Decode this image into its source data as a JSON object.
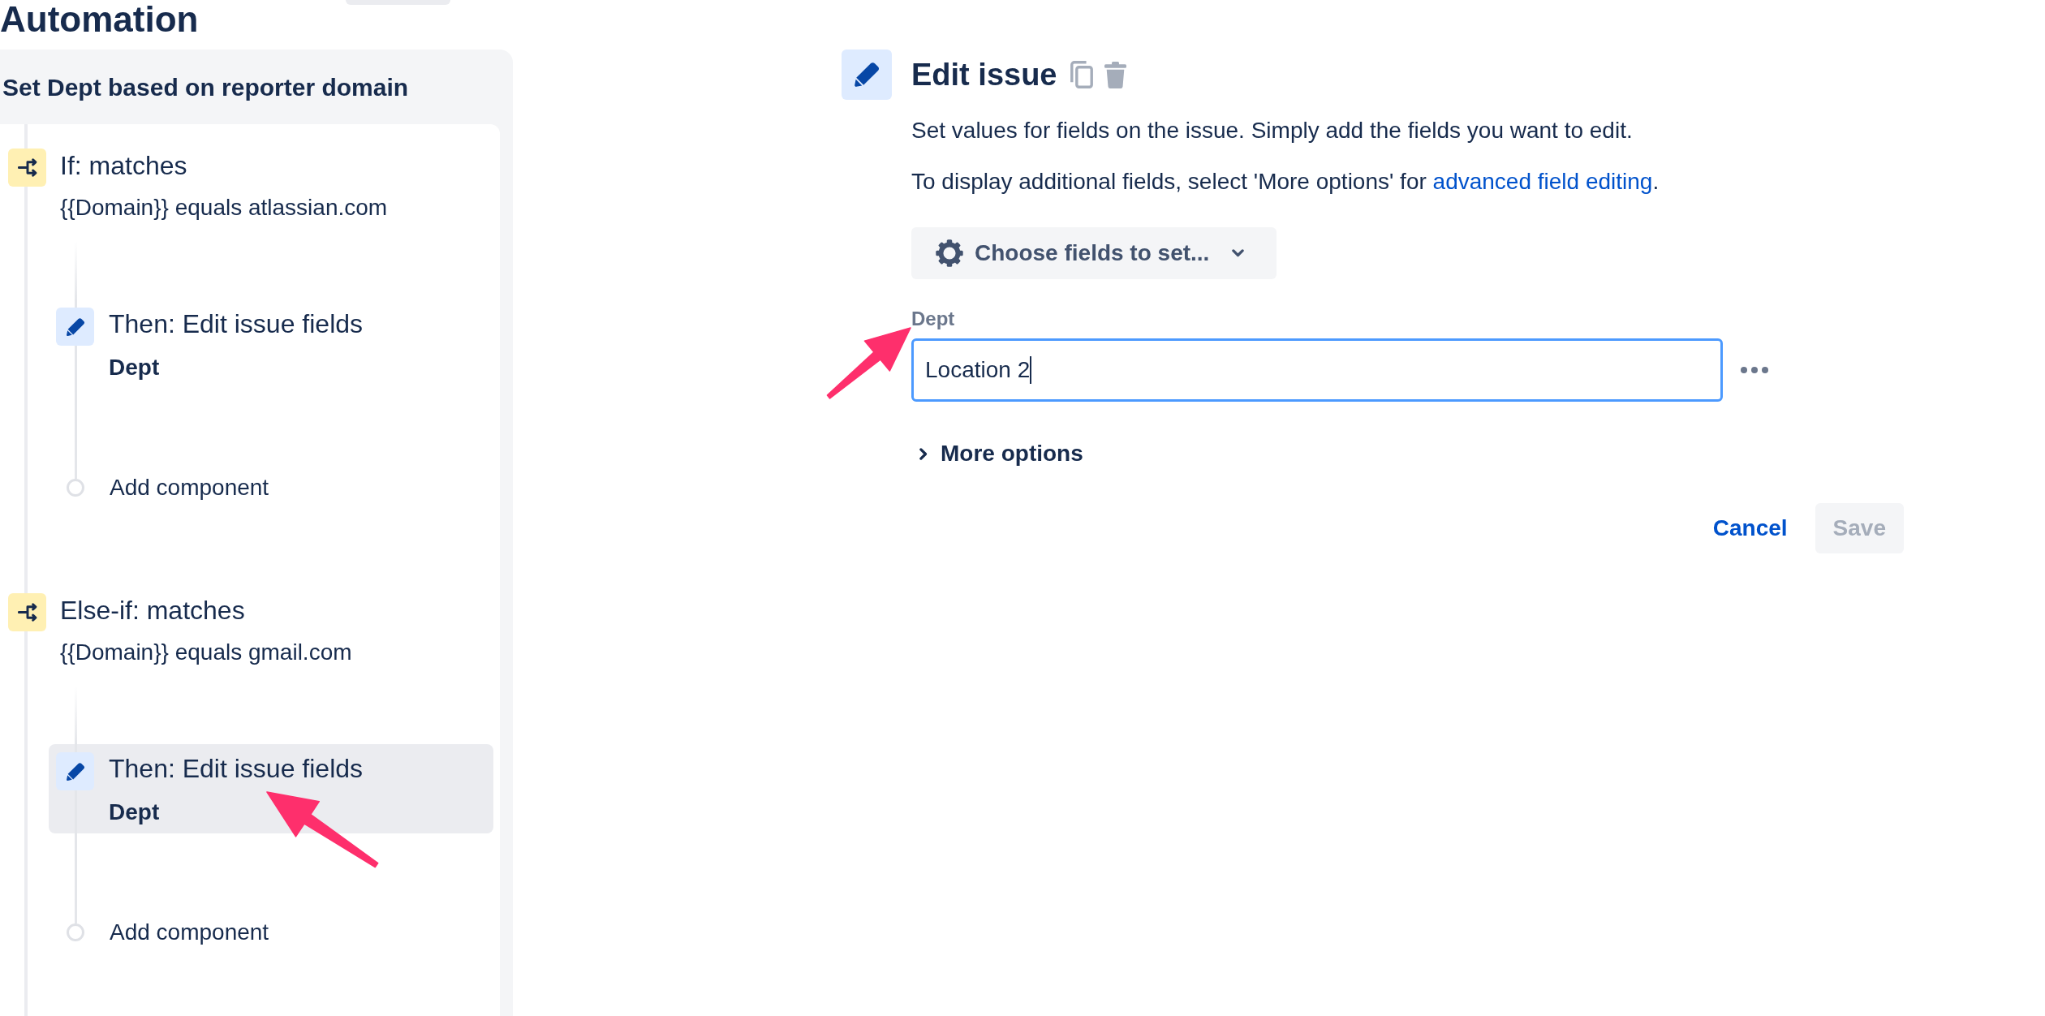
{
  "header": {
    "title": "Automation"
  },
  "rule": {
    "name": "Set Dept based on reporter domain",
    "components": [
      {
        "kind": "condition",
        "title": "If: matches",
        "detail": "{{Domain}} equals atlassian.com",
        "selected": false,
        "children": [
          {
            "kind": "action",
            "title": "Then: Edit issue fields",
            "detail": "Dept",
            "selected": false
          },
          {
            "kind": "add",
            "title": "Add component",
            "selected": false
          }
        ]
      },
      {
        "kind": "condition",
        "title": "Else-if: matches",
        "detail": "{{Domain}} equals gmail.com",
        "selected": false,
        "children": [
          {
            "kind": "action",
            "title": "Then: Edit issue fields",
            "detail": "Dept",
            "selected": true
          },
          {
            "kind": "add",
            "title": "Add component",
            "selected": false
          }
        ]
      }
    ]
  },
  "editor": {
    "title": "Edit issue",
    "description": "Set values for fields on the issue. Simply add the fields you want to edit.",
    "hint": {
      "text": "To display additional fields, select 'More options' for ",
      "link": "advanced field editing",
      "end": "."
    },
    "choose_fields": "Choose fields to set...",
    "fields": [
      {
        "label": "Dept",
        "value": "Location 2",
        "focused": true
      }
    ],
    "more_options": {
      "label": "More options",
      "expanded": false
    },
    "buttons": [
      {
        "kind": "link",
        "label": "Cancel",
        "disabled": false
      },
      {
        "kind": "primary",
        "label": "Save",
        "disabled": true
      }
    ]
  }
}
